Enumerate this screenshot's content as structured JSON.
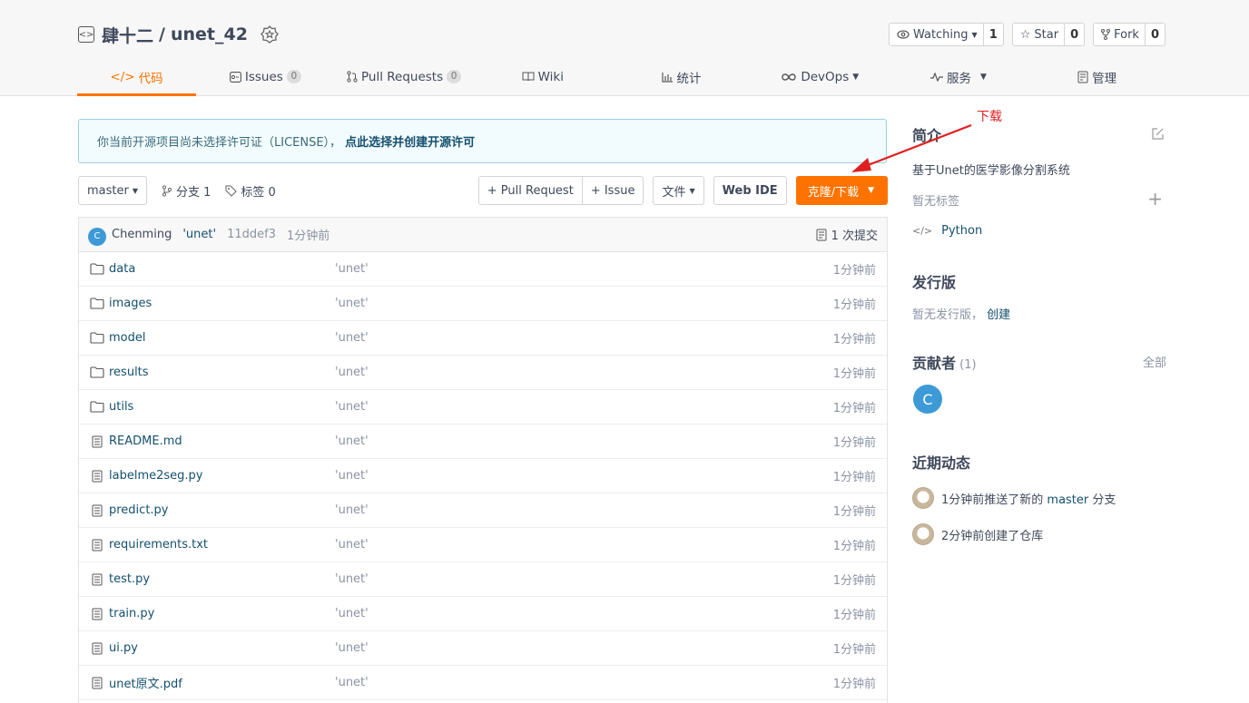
{
  "repo": {
    "owner": "肆十二",
    "separator": "/",
    "name": "unet_42"
  },
  "actions": [
    {
      "label": "Watching",
      "count": "1",
      "caret": true
    },
    {
      "label": "Star",
      "count": "0"
    },
    {
      "label": "Fork",
      "count": "0"
    }
  ],
  "nav": [
    {
      "icon": "</>",
      "label": "代码",
      "active": true
    },
    {
      "label": "Issues",
      "badge": "0"
    },
    {
      "label": "Pull Requests",
      "badge": "0"
    },
    {
      "label": "Wiki"
    },
    {
      "label": "统计"
    },
    {
      "label": "DevOps",
      "caret": true
    },
    {
      "label": "服务",
      "caret": true
    },
    {
      "label": "管理"
    }
  ],
  "license": {
    "text": "你当前开源项目尚未选择许可证（LICENSE），",
    "link": "点此选择并创建开源许可"
  },
  "toolbar": {
    "branch": "master",
    "branches": "分支 1",
    "tags": "标签 0",
    "pull_request": "+ Pull Request",
    "issue": "+ Issue",
    "file": "文件",
    "web_ide": "Web IDE",
    "clone": "克隆/下载"
  },
  "commit": {
    "avatar": "C",
    "author": "Chenming",
    "message": "'unet'",
    "sha": "11ddef3",
    "ago": "1分钟前",
    "count": "1 次提交"
  },
  "files": [
    {
      "type": "folder",
      "name": "data",
      "message": "'unet'",
      "time": "1分钟前"
    },
    {
      "type": "folder",
      "name": "images",
      "message": "'unet'",
      "time": "1分钟前"
    },
    {
      "type": "folder",
      "name": "model",
      "message": "'unet'",
      "time": "1分钟前"
    },
    {
      "type": "folder",
      "name": "results",
      "message": "'unet'",
      "time": "1分钟前"
    },
    {
      "type": "folder",
      "name": "utils",
      "message": "'unet'",
      "time": "1分钟前"
    },
    {
      "type": "file",
      "name": "README.md",
      "message": "'unet'",
      "time": "1分钟前"
    },
    {
      "type": "file",
      "name": "labelme2seg.py",
      "message": "'unet'",
      "time": "1分钟前"
    },
    {
      "type": "file",
      "name": "predict.py",
      "message": "'unet'",
      "time": "1分钟前"
    },
    {
      "type": "file",
      "name": "requirements.txt",
      "message": "'unet'",
      "time": "1分钟前"
    },
    {
      "type": "file",
      "name": "test.py",
      "message": "'unet'",
      "time": "1分钟前"
    },
    {
      "type": "file",
      "name": "train.py",
      "message": "'unet'",
      "time": "1分钟前"
    },
    {
      "type": "file",
      "name": "ui.py",
      "message": "'unet'",
      "time": "1分钟前"
    },
    {
      "type": "file",
      "name": "unet原文.pdf",
      "message": "'unet'",
      "time": "1分钟前"
    }
  ],
  "sidebar": {
    "intro_title": "简介",
    "intro_desc": "基于Unet的医学影像分割系统",
    "no_tags": "暂无标签",
    "language": "Python",
    "release_title": "发行版",
    "release_none": "暂无发行版，",
    "release_create": "创建",
    "contrib_title": "贡献者",
    "contrib_count": "(1)",
    "contrib_all": "全部",
    "contrib_avatar": "C",
    "activity_title": "近期动态",
    "activities": [
      {
        "prefix": "1分钟前推送了新的 ",
        "branch": "master",
        "suffix": " 分支"
      },
      {
        "prefix": "2分钟前创建了仓库",
        "branch": "",
        "suffix": ""
      }
    ]
  },
  "annotation": {
    "text": "下载",
    "color": "#e02020"
  },
  "colors": {
    "accent": "#fe7300",
    "link": "#14506e",
    "muted": "#8c92a4"
  }
}
